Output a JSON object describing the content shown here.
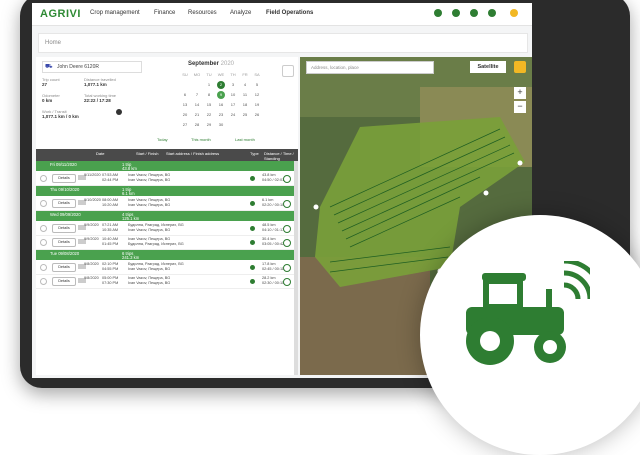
{
  "nav": {
    "logo": "AGRIVI",
    "items": [
      "Crop management",
      "Finance",
      "Resources",
      "Analyze",
      "Field Operations"
    ]
  },
  "breadcrumb": "Home",
  "vehicle": {
    "name": "John Deere 6120R",
    "stats": [
      {
        "label": "Trip count",
        "value": "27"
      },
      {
        "label": "Distance travelled",
        "value": "1,077.1 km"
      },
      {
        "label": "Odometer",
        "value": "0 km"
      },
      {
        "label": "Total working time",
        "value": "22:22 / 17:28"
      },
      {
        "label": "Work / Transit",
        "value": "1,077.1 km / 0 km"
      }
    ]
  },
  "calendar": {
    "month": "September",
    "year": "2020",
    "weekdays": [
      "SU",
      "MO",
      "TU",
      "WE",
      "TH",
      "FR",
      "SA"
    ],
    "days": [
      "",
      "",
      "1",
      "2",
      "3",
      "4",
      "5",
      "6",
      "7",
      "8",
      "9",
      "10",
      "11",
      "12",
      "13",
      "14",
      "15",
      "16",
      "17",
      "18",
      "19",
      "20",
      "21",
      "22",
      "23",
      "24",
      "25",
      "26",
      "27",
      "28",
      "29",
      "30",
      "",
      "",
      ""
    ],
    "buttons": [
      "Today",
      "This month",
      "Last month"
    ]
  },
  "table": {
    "headers": [
      "Date",
      "Start / Finish",
      "Start address / Finish address",
      "Type",
      "Distance / Time / Standing"
    ],
    "groups": [
      {
        "label": "Fri 09/11/2020",
        "trips": "1 trip",
        "dist": "43.8 km"
      },
      {
        "label": "Thu 09/10/2020",
        "trips": "1 trip",
        "dist": "6.1 km"
      },
      {
        "label": "Wed 09/09/2020",
        "trips": "4 trips",
        "dist": "125.1 km"
      },
      {
        "label": "Tue 09/08/2020",
        "trips": "6 trips",
        "dist": "241.3 km"
      }
    ],
    "detail": "Details",
    "rows": [
      {
        "date": "9/11/2020",
        "t1": "07:53 AM",
        "t2": "02:44 PM",
        "a1": "Ivan Vazov, Пещера, BG",
        "a2": "Ivan Vazov, Пещера, BG",
        "d1": "43.8 km",
        "d2": "04:50 / 02:01"
      },
      {
        "date": "9/10/2020",
        "t1": "08:00 AM",
        "t2": "10:20 AM",
        "a1": "Ivan Vazov, Пещера, BG",
        "a2": "Ivan Vazov, Пещера, BG",
        "d1": "6.1 km",
        "d2": "02:20 / 00:10"
      },
      {
        "date": "9/9/2020",
        "t1": "07:21 AM",
        "t2": "10:35 AM",
        "a1": "Будилна, Разград, Исперих, BG",
        "a2": "Ivan Vazov, Пещера, BG",
        "d1": "48.5 km",
        "d2": "04:10 / 01:17"
      },
      {
        "date": "9/9/2020",
        "t1": "10:40 AM",
        "t2": "01:45 PM",
        "a1": "Ivan Vazov, Пещера, BG",
        "a2": "Будилна, Разград, Исперих, BG",
        "d1": "30.4 km",
        "d2": "03:05 / 00:42"
      },
      {
        "date": "9/8/2020",
        "t1": "02:10 PM",
        "t2": "04:55 PM",
        "a1": "Будилна, Разград, Исперих, BG",
        "a2": "Ivan Vazov, Пещера, BG",
        "d1": "17.8 km",
        "d2": "02:45 / 00:11"
      },
      {
        "date": "9/8/2020",
        "t1": "05:00 PM",
        "t2": "07:30 PM",
        "a1": "Ivan Vazov, Пещера, BG",
        "a2": "Ivan Vazov, Пещера, BG",
        "d1": "28.2 km",
        "d2": "02:30 / 00:15"
      }
    ]
  },
  "map": {
    "search": "Address, location, place",
    "layer": "Satellite",
    "zoom_in": "+",
    "zoom_out": "−"
  },
  "colors": {
    "brand": "#2e8a34",
    "field": "#7aa03a",
    "track": "#2e7d32"
  }
}
